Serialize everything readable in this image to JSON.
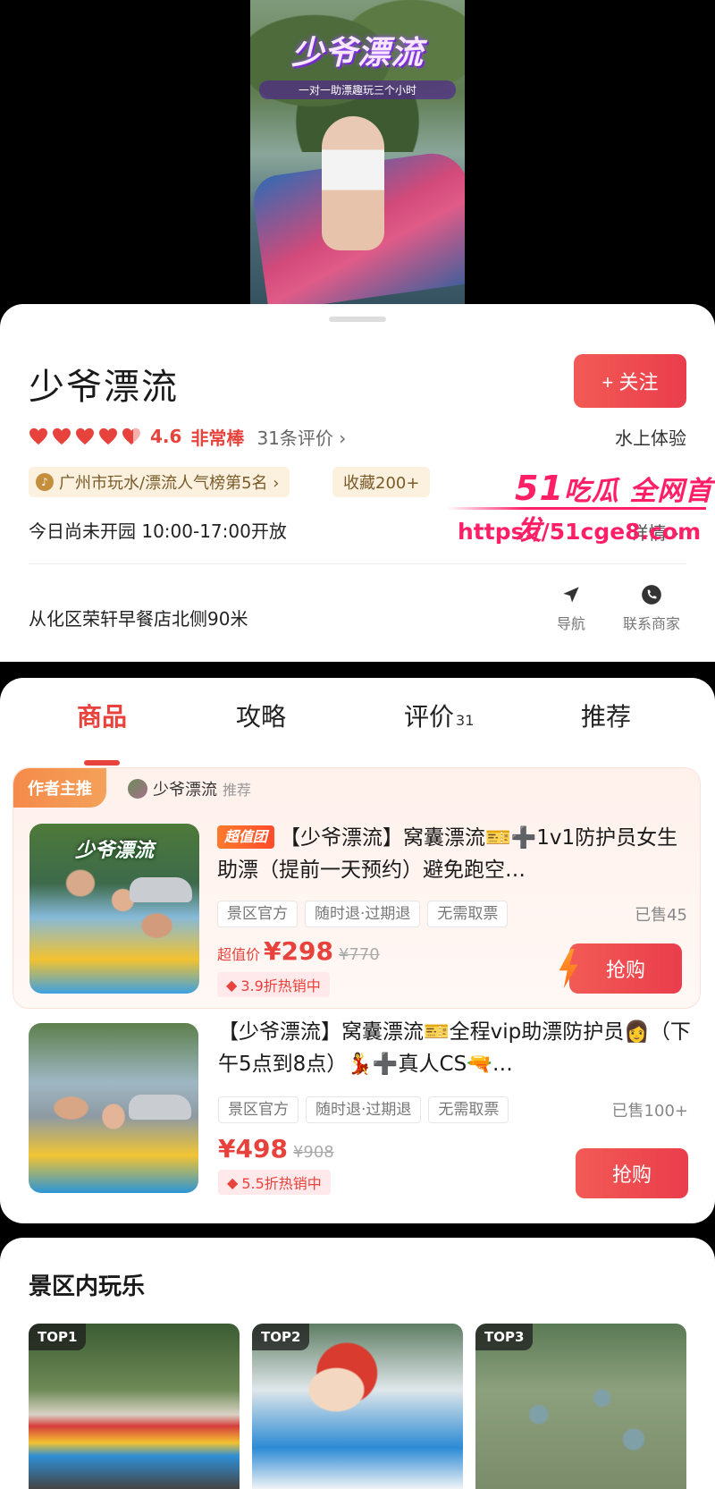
{
  "hero": {
    "title": "少爷漂流",
    "subtitle": "一对一助漂趣玩三个小时"
  },
  "shop": {
    "name": "少爷漂流",
    "follow_label": "+ 关注",
    "rating_hearts": 5,
    "rating_score": "4.6",
    "rating_word": "非常棒",
    "review_count": "31条评价 ›",
    "category": "水上体验",
    "rank_badge": "广州市玩水/漂流人气榜第5名 ›",
    "favorites_badge": "收藏200+",
    "hours": "今日尚未开园 10:00-17:00开放",
    "detail_link": "详情 ›",
    "address": "从化区荣轩早餐店北侧90米",
    "actions": [
      {
        "label": "导航",
        "icon": "navigation-arrow-icon"
      },
      {
        "label": "联系商家",
        "icon": "phone-icon"
      }
    ],
    "heart_color": "#e8423c"
  },
  "watermark": {
    "line1_num": "51",
    "line1_text": "吃瓜 全网首发",
    "line2": "https://51cge8.com"
  },
  "tabs": [
    {
      "label": "商品",
      "active": true
    },
    {
      "label": "攻略",
      "active": false
    },
    {
      "label": "评价",
      "count": "31",
      "active": false
    },
    {
      "label": "推荐",
      "active": false
    }
  ],
  "featured": {
    "author_tag": "作者主推",
    "author_name": "少爷漂流",
    "author_rec": "推荐"
  },
  "products": [
    {
      "thumb_title": "少爷漂流",
      "deal_badge": "超值团",
      "title": "【少爷漂流】窝囊漂流🎫➕1v1防护员女生助漂（提前一天预约）避免跑空…",
      "tags": [
        "景区官方",
        "随时退·过期退",
        "无需取票"
      ],
      "sold": "已售45",
      "price_label": "超值价",
      "price_now": "¥298",
      "price_old": "¥770",
      "discount": "3.9折热销中",
      "buy_label": "抢购"
    },
    {
      "title": "【少爷漂流】窝囊漂流🎫全程vip助漂防护员👩（下午5点到8点）💃➕真人CS🔫…",
      "tags": [
        "景区官方",
        "随时退·过期退",
        "无需取票"
      ],
      "sold": "已售100+",
      "price_now": "¥498",
      "price_old": "¥908",
      "discount": "5.5折热销中",
      "buy_label": "抢购"
    }
  ],
  "scenic": {
    "title": "景区内玩乐",
    "tiles": [
      {
        "label": "TOP1"
      },
      {
        "label": "TOP2"
      },
      {
        "label": "TOP3"
      }
    ]
  },
  "colors": {
    "accent": "#e8423c",
    "follow_button": "#ea3d4c",
    "watermark": "#ff1f67"
  }
}
